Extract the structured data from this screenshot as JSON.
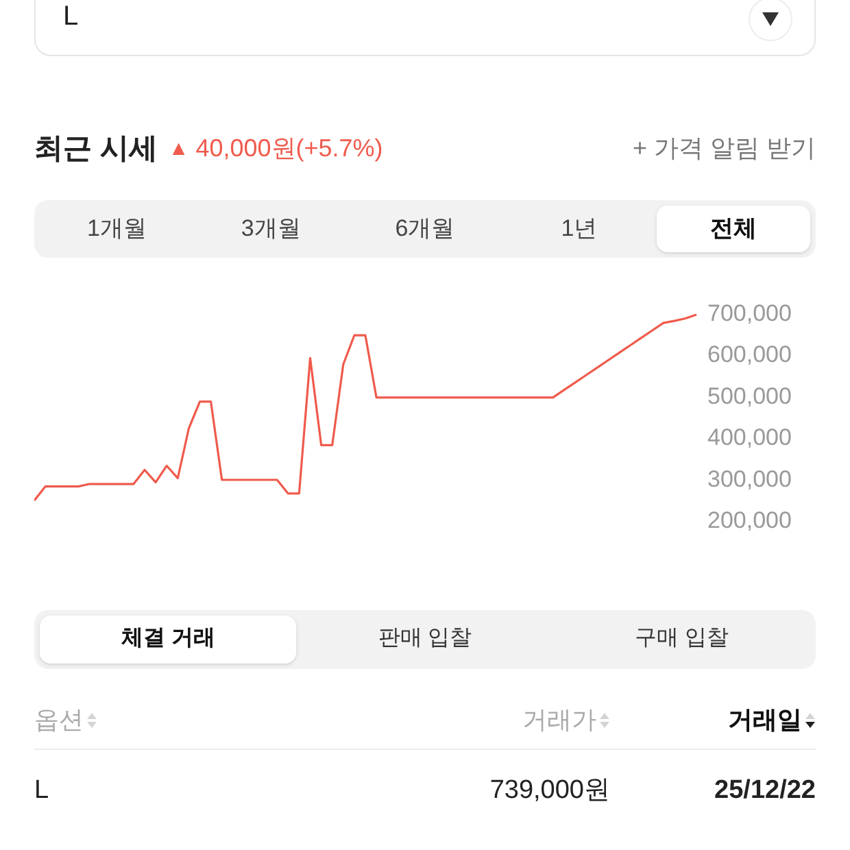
{
  "option_select": {
    "value": "L"
  },
  "price_header": {
    "title": "최근 시세",
    "trend_symbol": "▲",
    "change": "40,000원(+5.7%)",
    "alert_link": "+ 가격 알림 받기"
  },
  "period_tabs": [
    {
      "label": "1개월",
      "selected": false
    },
    {
      "label": "3개월",
      "selected": false
    },
    {
      "label": "6개월",
      "selected": false
    },
    {
      "label": "1년",
      "selected": false
    },
    {
      "label": "전체",
      "selected": true
    }
  ],
  "chart": {
    "chart_data": {
      "type": "line",
      "ylim": [
        200000,
        700000
      ],
      "yticks": [
        {
          "value": 700000,
          "label": "700,000"
        },
        {
          "value": 600000,
          "label": "600,000"
        },
        {
          "value": 500000,
          "label": "500,000"
        },
        {
          "value": 400000,
          "label": "400,000"
        },
        {
          "value": 300000,
          "label": "300,000"
        },
        {
          "value": 200000,
          "label": "200,000"
        }
      ],
      "series": [
        {
          "color": "#ef5b4c",
          "values": [
            246000,
            280000,
            280000,
            280000,
            280000,
            286000,
            286000,
            286000,
            286000,
            286000,
            320000,
            290000,
            330000,
            300000,
            420000,
            485000,
            485000,
            296000,
            296000,
            296000,
            296000,
            296000,
            296000,
            263000,
            263000,
            590000,
            380000,
            380000,
            575000,
            645000,
            645000,
            495000,
            495000,
            495000,
            495000,
            495000,
            495000,
            495000,
            495000,
            495000,
            495000,
            495000,
            495000,
            495000,
            495000,
            495000,
            495000,
            495000,
            513000,
            531000,
            549000,
            567000,
            585000,
            603000,
            621000,
            639000,
            657000,
            675000,
            680000,
            686000,
            695000
          ]
        }
      ]
    }
  },
  "trade_tabs": [
    {
      "label": "체결 거래",
      "selected": true
    },
    {
      "label": "판매 입찰",
      "selected": false
    },
    {
      "label": "구매 입찰",
      "selected": false
    }
  ],
  "table": {
    "columns": [
      {
        "label": "옵션",
        "selected": false
      },
      {
        "label": "거래가",
        "selected": false
      },
      {
        "label": "거래일",
        "selected": true
      }
    ],
    "rows": [
      [
        "L",
        "739,000원",
        "25/12/22"
      ]
    ]
  }
}
